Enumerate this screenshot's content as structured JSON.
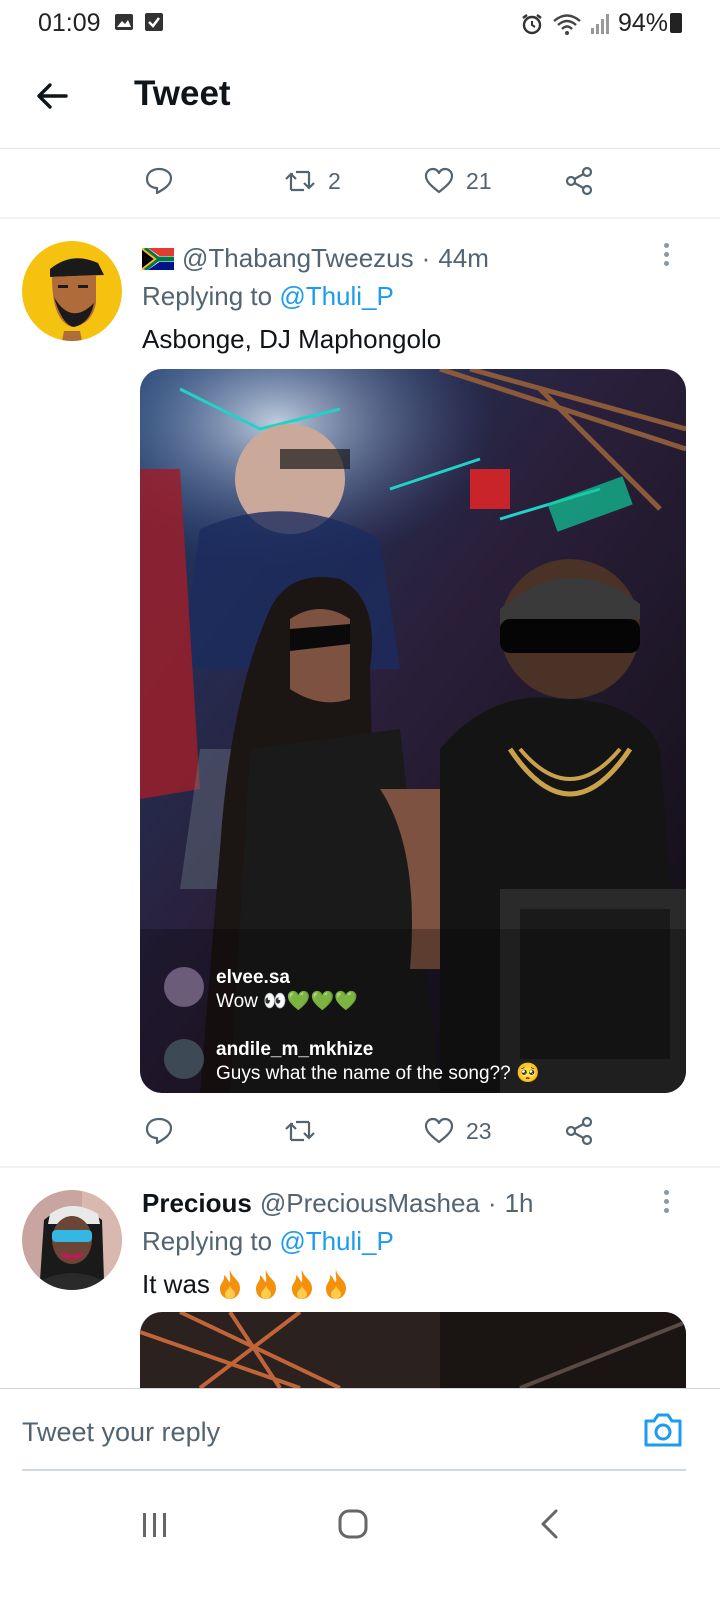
{
  "status": {
    "time": "01:09",
    "battery": "94%"
  },
  "header": {
    "title": "Tweet"
  },
  "prev_actions": {
    "retweets": "2",
    "likes": "21"
  },
  "tweet1": {
    "handle": "@ThabangTweezus",
    "sep": "·",
    "time": "44m",
    "replying_label": "Replying to",
    "replying_to": "@Thuli_P",
    "text": "Asbonge, DJ Maphongolo",
    "media_comments": [
      {
        "user": "elvee.sa",
        "text": "Wow 👀💚💚💚"
      },
      {
        "user": "andile_m_mkhize",
        "text": "Guys what the name of the song?? 🥺"
      }
    ],
    "likes": "23"
  },
  "tweet2": {
    "name": "Precious",
    "handle": "@PreciousMashea",
    "sep": "·",
    "time": "1h",
    "replying_label": "Replying to",
    "replying_to": "@Thuli_P",
    "text": "It was"
  },
  "reply_bar": {
    "placeholder": "Tweet your reply"
  },
  "colors": {
    "accent": "#1d9bf0",
    "muted": "#536471",
    "divider": "#eff3f4"
  }
}
